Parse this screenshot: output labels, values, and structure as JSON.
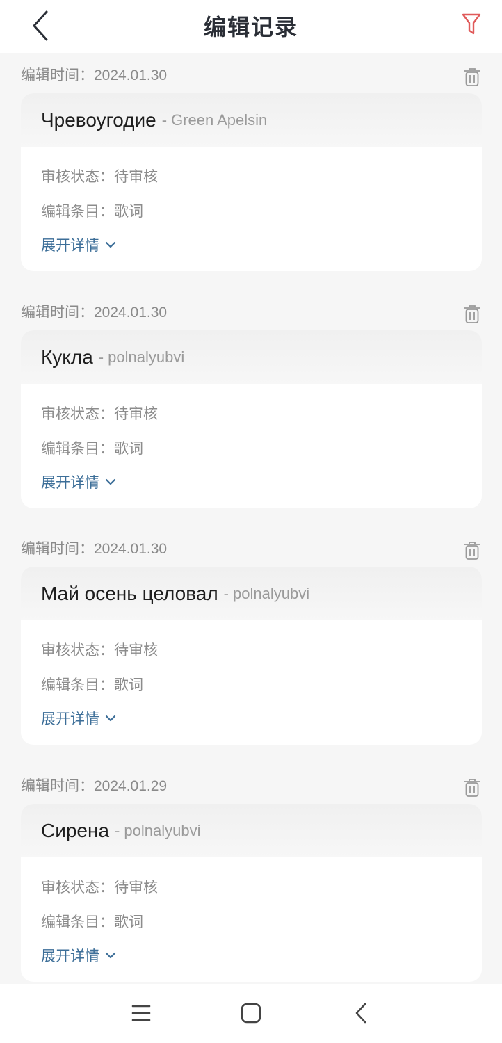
{
  "header": {
    "title": "编辑记录",
    "back_icon": "back-arrow-icon",
    "filter_icon": "filter-icon",
    "filter_color": "#e05a5a"
  },
  "records": [
    {
      "time_label": "编辑时间：",
      "time": "2024.01.30",
      "song_title": "Чревоугодие",
      "separator": "-",
      "artist": "Green Apelsin",
      "status_label": "审核状态：",
      "status": "待审核",
      "item_label": "编辑条目：",
      "item": "歌词",
      "expand_label": "展开详情"
    },
    {
      "time_label": "编辑时间：",
      "time": "2024.01.30",
      "song_title": "Кукла",
      "separator": "-",
      "artist": "polnalyubvi",
      "status_label": "审核状态：",
      "status": "待审核",
      "item_label": "编辑条目：",
      "item": "歌词",
      "expand_label": "展开详情"
    },
    {
      "time_label": "编辑时间：",
      "time": "2024.01.30",
      "song_title": "Май осень целовал",
      "separator": "-",
      "artist": "polnalyubvi",
      "status_label": "审核状态：",
      "status": "待审核",
      "item_label": "编辑条目：",
      "item": "歌词",
      "expand_label": "展开详情"
    },
    {
      "time_label": "编辑时间：",
      "time": "2024.01.29",
      "song_title": "Сирена",
      "separator": "-",
      "artist": "polnalyubvi",
      "status_label": "审核状态：",
      "status": "待审核",
      "item_label": "编辑条目：",
      "item": "歌词",
      "expand_label": "展开详情"
    }
  ],
  "colors": {
    "accent_link": "#3c6e98",
    "background": "#f6f6f6"
  },
  "system_nav": {
    "recents_icon": "menu-lines-icon",
    "home_icon": "home-square-icon",
    "back_icon": "back-chevron-icon"
  }
}
